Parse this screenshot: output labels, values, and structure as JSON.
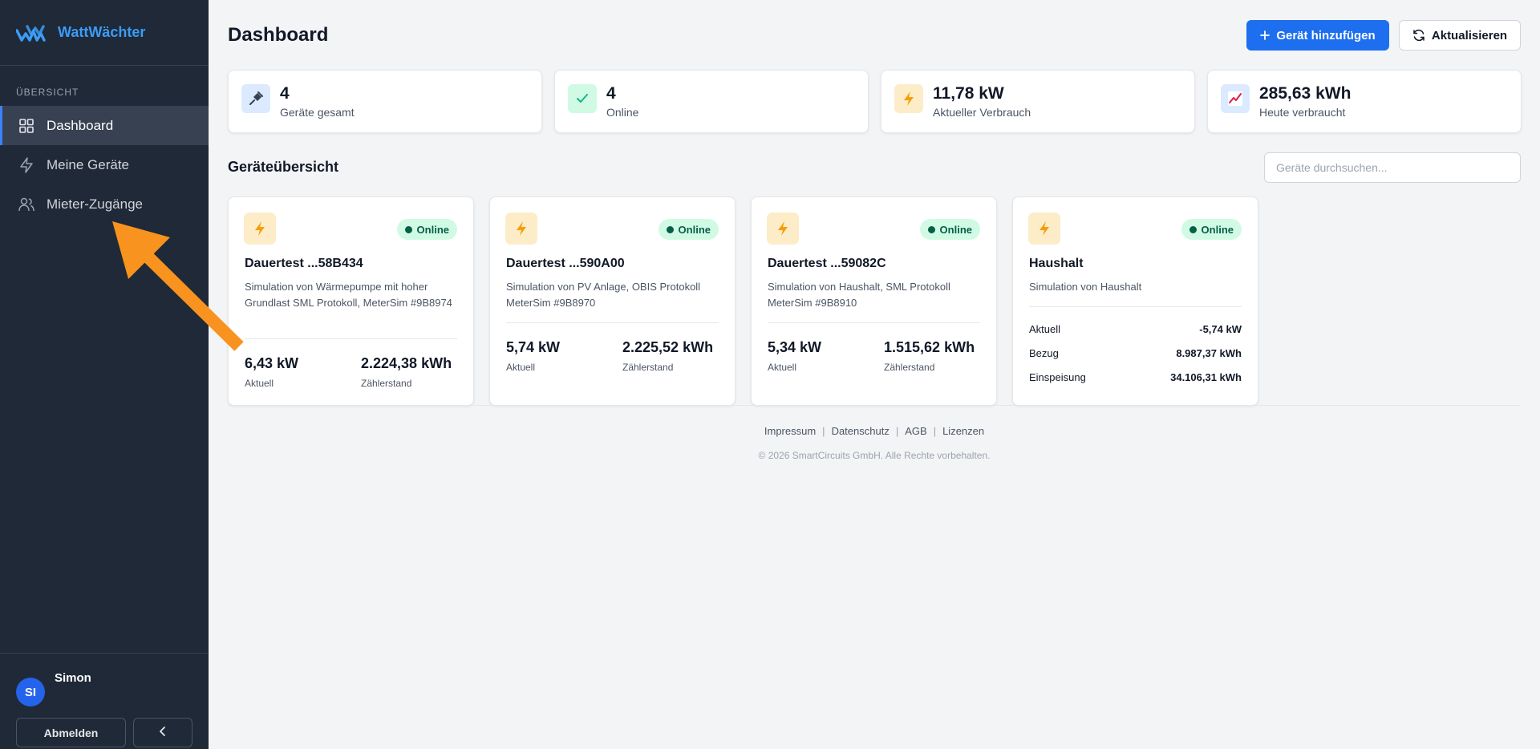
{
  "brand": {
    "name": "WattWächter"
  },
  "sidebar": {
    "section_label": "ÜBERSICHT",
    "items": [
      {
        "label": "Dashboard",
        "icon": "grid-icon",
        "active": true
      },
      {
        "label": "Meine Geräte",
        "icon": "bolt-icon",
        "active": false
      },
      {
        "label": "Mieter-Zugänge",
        "icon": "users-icon",
        "active": false
      }
    ],
    "user": {
      "initials": "SI",
      "name": "Simon"
    },
    "logout_label": "Abmelden",
    "collapse_icon": "chevron-left-icon"
  },
  "header": {
    "title": "Dashboard",
    "add_device_label": "Gerät hinzufügen",
    "refresh_label": "Aktualisieren"
  },
  "stats": [
    {
      "value": "4",
      "label": "Geräte gesamt",
      "icon": "plug-icon",
      "color": "#dbeafe"
    },
    {
      "value": "4",
      "label": "Online",
      "icon": "check-icon",
      "color": "#d1fae5"
    },
    {
      "value": "11,78 kW",
      "label": "Aktueller Verbrauch",
      "icon": "bolt-icon",
      "color": "#fdecc8"
    },
    {
      "value": "285,63 kWh",
      "label": "Heute verbraucht",
      "icon": "chart-icon",
      "color": "#dbeafe"
    }
  ],
  "devices_section": {
    "title": "Geräteübersicht",
    "search_placeholder": "Geräte durchsuchen..."
  },
  "devices": [
    {
      "status": "Online",
      "name": "Dauertest ...58B434",
      "description": "Simulation von Wärmepumpe mit hoher Grundlast SML Protokoll, MeterSim #9B8974",
      "current_value": "6,43 kW",
      "current_label": "Aktuell",
      "meter_value": "2.224,38 kWh",
      "meter_label": "Zählerstand"
    },
    {
      "status": "Online",
      "name": "Dauertest ...590A00",
      "description": "Simulation von PV Anlage, OBIS Protokoll MeterSim #9B8970",
      "current_value": "5,74 kW",
      "current_label": "Aktuell",
      "meter_value": "2.225,52 kWh",
      "meter_label": "Zählerstand"
    },
    {
      "status": "Online",
      "name": "Dauertest ...59082C",
      "description": "Simulation von Haushalt, SML Protokoll MeterSim #9B8910",
      "current_value": "5,34 kW",
      "current_label": "Aktuell",
      "meter_value": "1.515,62 kWh",
      "meter_label": "Zählerstand"
    },
    {
      "status": "Online",
      "name": "Haushalt",
      "description": "Simulation von Haushalt",
      "rows": [
        {
          "label": "Aktuell",
          "value": "-5,74 kW"
        },
        {
          "label": "Bezug",
          "value": "8.987,37 kWh"
        },
        {
          "label": "Einspeisung",
          "value": "34.106,31 kWh"
        }
      ]
    }
  ],
  "footer": {
    "links": [
      "Impressum",
      "Datenschutz",
      "AGB",
      "Lizenzen"
    ],
    "copyright": "© 2026 SmartCircuits GmbH. Alle Rechte vorbehalten."
  },
  "colors": {
    "sidebar_bg": "#1f2937",
    "accent": "#1d6ff0",
    "online": "#065f46",
    "annotation_arrow": "#f7931e"
  }
}
